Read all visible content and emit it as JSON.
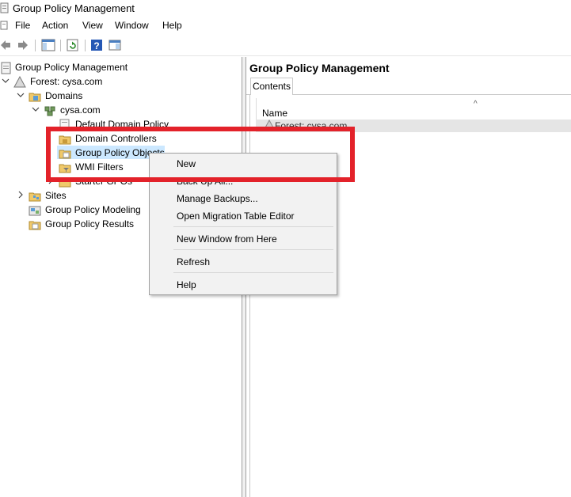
{
  "window": {
    "title": "Group Policy Management"
  },
  "menubar": {
    "items": [
      "File",
      "Action",
      "View",
      "Window",
      "Help"
    ]
  },
  "toolbar": {
    "buttons": [
      "back-arrow-icon",
      "forward-arrow-icon",
      "show-hide-tree-icon",
      "refresh-icon",
      "help-icon",
      "properties-pane-icon"
    ]
  },
  "tree": {
    "root": "Group Policy Management",
    "forest": "Forest: cysa.com",
    "domains": "Domains",
    "domain": "cysa.com",
    "default_policy": "Default Domain Policy",
    "domain_controllers": "Domain Controllers",
    "gpo": "Group Policy Objects",
    "wmi": "WMI Filters",
    "starter": "Starter GPOs",
    "sites": "Sites",
    "modeling": "Group Policy Modeling",
    "results": "Group Policy Results"
  },
  "right": {
    "header": "Group Policy Management",
    "tab": "Contents",
    "column_name": "Name",
    "rows": [
      "Forest: cysa.com"
    ]
  },
  "context_menu": {
    "items": [
      "New",
      "Back Up All...",
      "Manage Backups...",
      "Open Migration Table Editor",
      "New Window from Here",
      "Refresh",
      "Help"
    ]
  },
  "colors": {
    "highlight_border": "#e3222a",
    "selection": "#cce8ff"
  }
}
